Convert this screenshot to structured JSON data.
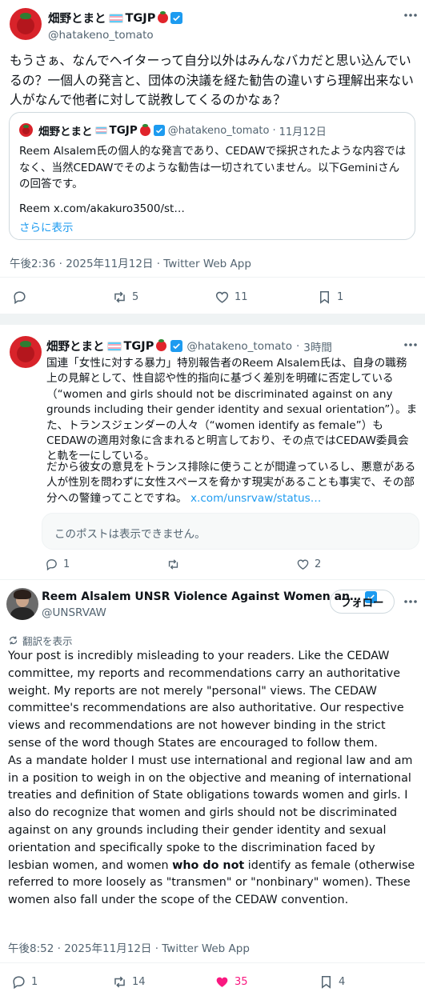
{
  "tweet1": {
    "name": "畑野とまと",
    "name_suffix": "TGJP",
    "handle": "@hatakeno_tomato",
    "text": "もうさぁ、なんでヘイターって自分以外はみんなバカだと思い込んでいるの？一個人の発言と、団体の決議を経た勧告の違いすら理解出来ない人がなんで他者に対して説教してくるのかなぁ？",
    "quote": {
      "name": "畑野とまと",
      "name_suffix": "TGJP",
      "handle": "@hatakeno_tomato",
      "date": "11月12日",
      "text": "Reem Alsalem氏の個人的な発言であり、CEDAWで採択されたような内容ではなく、当然CEDAWでそのような勧告は一切されていません。以下Geminiさんの回答です。",
      "link_text": "Reem x.com/akakuro3500/st…",
      "show_more": "さらに表示"
    },
    "timestamp": "午後2:36 · 2025年11月12日 · Twitter Web App",
    "actions": {
      "replies": "",
      "retweets": "5",
      "likes": "11",
      "bookmarks": "1"
    }
  },
  "tweet2": {
    "name": "畑野とまと",
    "name_suffix": "TGJP",
    "handle": "@hatakeno_tomato",
    "time": "3時間",
    "text_p1": "国連「女性に対する暴力」特別報告者のReem Alsalem氏は、自身の職務上の見解として、性自認や性的指向に基づく差別を明確に否定している（“women and girls should not be discriminated against on any grounds including their gender identity and sexual orientation”）。また、トランスジェンダーの人々（“women identify as female”）もCEDAWの適用対象に含まれると明言しており、その点ではCEDAW委員会と軌を一にしている。",
    "text_p2": "だから彼女の意見をトランス排除に使うことが間違っているし、悪意がある人が性別を問わずに女性スペースを脅かす現実があることも事実で、その部分への警鐘ってことですね。",
    "link": "x.com/unsrvaw/status…",
    "unavailable": "このポストは表示できません。",
    "actions": {
      "replies": "1",
      "retweets": "",
      "likes": "2"
    }
  },
  "tweet3": {
    "name": "Reem Alsalem UNSR Violence Against Women an…",
    "handle": "@UNSRVAW",
    "follow_label": "フォロー",
    "translate": "翻訳を表示",
    "text_a": "Your post is incredibly misleading to your readers. Like the CEDAW committee, my reports and recommendations carry an authoritative weight. My reports are not merely \"personal\" views. The CEDAW committee's recommendations are also authoritative. Our respective views and recommendations are not however binding in the strict sense of the word though States are encouraged to follow them.",
    "text_b": "As a mandate holder I must use international and regional law and am in a position to weigh in on the objective and meaning of international treaties and definition of State obligations towards women and girls. I also do recognize that women and girls should not be discriminated against on any grounds including their gender identity and sexual orientation and specifically spoke to the discrimination faced by lesbian women, and women",
    "text_bold": "who do not",
    "text_c": "identify as female (otherwise referred to more loosely as \"transmen\" or \"nonbinary\" women). These women also fall under the scope of the CEDAW convention.",
    "timestamp": "午後8:52 · 2025年11月12日 · Twitter Web App",
    "actions": {
      "replies": "1",
      "retweets": "14",
      "likes": "35",
      "bookmarks": "4"
    }
  },
  "colors": {
    "accent": "#1d9bf0",
    "like": "#f91880",
    "muted": "#536471"
  }
}
